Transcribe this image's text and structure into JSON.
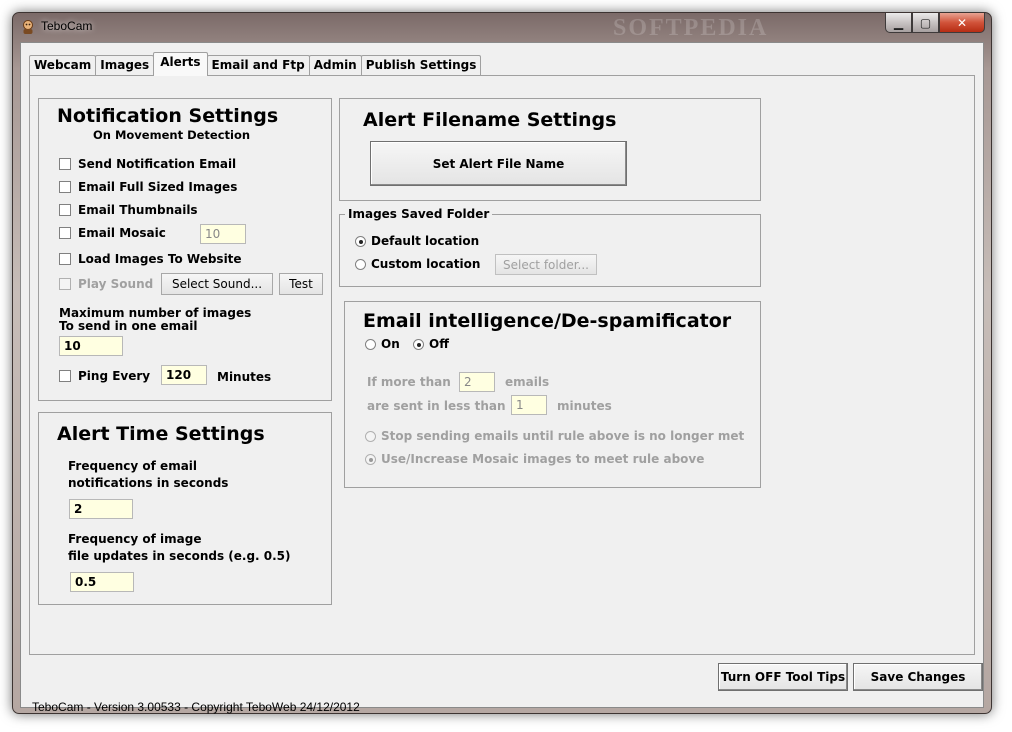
{
  "window": {
    "title": "TeboCam",
    "watermark": "SOFTPEDIA"
  },
  "tabs": [
    {
      "label": "Webcam",
      "active": false
    },
    {
      "label": "Images",
      "active": false
    },
    {
      "label": "Alerts",
      "active": true
    },
    {
      "label": "Email and Ftp",
      "active": false
    },
    {
      "label": "Admin",
      "active": false
    },
    {
      "label": "Publish Settings",
      "active": false
    }
  ],
  "notification": {
    "title": "Notification Settings",
    "subtitle": "On Movement Detection",
    "send_email": {
      "label": "Send Notification Email",
      "checked": false
    },
    "email_full": {
      "label": "Email Full Sized Images",
      "checked": false
    },
    "email_thumbs": {
      "label": "Email Thumbnails",
      "checked": false
    },
    "email_mosaic": {
      "label": "Email Mosaic",
      "checked": false,
      "value": "10"
    },
    "load_images": {
      "label": "Load Images To Website",
      "checked": false
    },
    "play_sound": {
      "label": "Play Sound",
      "checked": false,
      "disabled": true
    },
    "select_sound_label": "Select Sound...",
    "test_label": "Test",
    "max_images_label_1": "Maximum number of images",
    "max_images_label_2": "To send in one email",
    "max_images_value": "10",
    "ping": {
      "label": "Ping Every",
      "checked": false,
      "value": "120",
      "unit": "Minutes"
    }
  },
  "alert_time": {
    "title": "Alert Time Settings",
    "email_freq_label_1": "Frequency of email",
    "email_freq_label_2": "notifications in seconds",
    "email_freq_value": "2",
    "image_freq_label_1": "Frequency of image",
    "image_freq_label_2": "file updates in seconds (e.g. 0.5)",
    "image_freq_value": "0.5"
  },
  "alert_filename": {
    "title": "Alert Filename Settings",
    "button_label": "Set Alert File Name"
  },
  "images_saved": {
    "legend": "Images Saved Folder",
    "default_label": "Default location",
    "default_selected": true,
    "custom_label": "Custom location",
    "custom_selected": false,
    "select_folder_label": "Select folder..."
  },
  "email_intel": {
    "title": "Email intelligence/De-spamificator",
    "on_label": "On",
    "off_label": "Off",
    "selected": "Off",
    "more_than_label": "If more than",
    "more_than_value": "2",
    "emails_label": "emails",
    "less_than_label": "are sent in less than",
    "less_than_value": "1",
    "minutes_label": "minutes",
    "stop_label": "Stop sending emails until rule above is no longer met",
    "mosaic_label": "Use/Increase Mosaic images to meet rule above"
  },
  "buttons": {
    "tooltips_label": "Turn OFF Tool Tips",
    "save_label": "Save Changes"
  },
  "status": "TeboCam - Version 3.00533 - Copyright TeboWeb 24/12/2012"
}
